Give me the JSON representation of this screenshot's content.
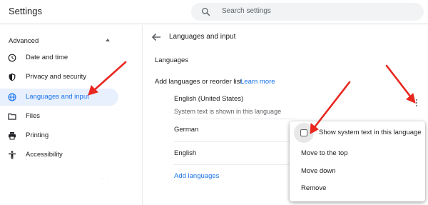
{
  "app": {
    "title": "Settings"
  },
  "search": {
    "placeholder": "Search settings",
    "icon": "search-icon"
  },
  "sidebar": {
    "section": "Advanced",
    "items": [
      {
        "label": "Date and time",
        "icon": "clock-icon",
        "active": false
      },
      {
        "label": "Privacy and security",
        "icon": "shield-icon",
        "active": false
      },
      {
        "label": "Languages and input",
        "icon": "globe-icon",
        "active": true
      },
      {
        "label": "Files",
        "icon": "folder-icon",
        "active": false
      },
      {
        "label": "Printing",
        "icon": "printer-icon",
        "active": false
      },
      {
        "label": "Accessibility",
        "icon": "accessibility-icon",
        "active": false
      }
    ]
  },
  "main": {
    "page_title": "Languages and input",
    "section_title": "Languages",
    "add_text": "Add languages or reorder list.",
    "learn_more": "Learn more",
    "languages": [
      {
        "name": "English (United States)",
        "sub": "System text is shown in this language"
      },
      {
        "name": "German"
      },
      {
        "name": "English"
      }
    ],
    "add_languages": "Add languages"
  },
  "menu": {
    "items": [
      "Show system text in this language",
      "Move to the top",
      "Move down",
      "Remove"
    ]
  },
  "colors": {
    "accent": "#1a73e8",
    "annotation_arrow": "#e8271f",
    "active_bg": "#e8f0fe"
  }
}
